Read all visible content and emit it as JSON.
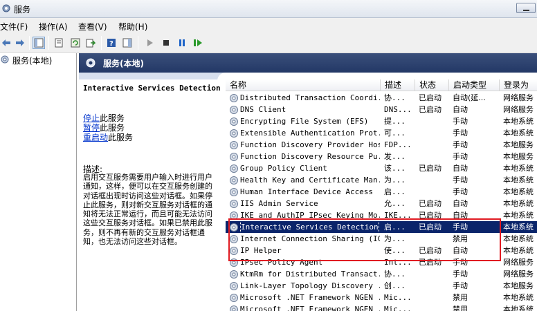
{
  "window": {
    "title": "服务"
  },
  "menu": {
    "file": "文件(F)",
    "action": "操作(A)",
    "view": "查看(V)",
    "help": "帮助(H)"
  },
  "toolbar": {
    "icons": [
      "back-arrow-icon",
      "forward-arrow-icon",
      "console-tree-icon",
      "properties-icon",
      "refresh-icon",
      "export-icon",
      "help-icon",
      "show-hide-icon",
      "start-icon",
      "stop-icon",
      "pause-icon",
      "restart-icon"
    ]
  },
  "tree": {
    "root_label": "服务(本地)"
  },
  "pane_header": {
    "title": "服务(本地)"
  },
  "details": {
    "service_name": "Interactive Services Detection",
    "actions": [
      {
        "link": "停止",
        "suffix": "此服务"
      },
      {
        "link": "暂停",
        "suffix": "此服务"
      },
      {
        "link": "重启动",
        "suffix": "此服务"
      }
    ],
    "description_label": "描述:",
    "description_text": "启用交互服务需要用户输入时进行用户通知，这样，便可以在交互服务创建的对话框出现时访问这些对话框。如果停止此服务，则对新交互服务对话框的通知将无法正常运行，而且可能无法访问这些交互服务对话框。如果已禁用此服务，则不再有新的交互服务对话框通知，也无法访问这些对话框。"
  },
  "columns": {
    "name": "名称",
    "description": "描述",
    "status": "状态",
    "startup_type": "启动类型",
    "logon_as": "登录为"
  },
  "services": [
    {
      "name": "Distributed Transaction Coordi...",
      "description": "协...",
      "status": "已启动",
      "startup": "自动(延...",
      "logon": "网络服务"
    },
    {
      "name": "DNS Client",
      "description": "DNS...",
      "status": "已启动",
      "startup": "自动",
      "logon": "网络服务"
    },
    {
      "name": "Encrypting File System (EFS)",
      "description": "提...",
      "status": "",
      "startup": "手动",
      "logon": "本地系统"
    },
    {
      "name": "Extensible Authentication Prot...",
      "description": "可...",
      "status": "",
      "startup": "手动",
      "logon": "本地系统"
    },
    {
      "name": "Function Discovery Provider Host",
      "description": "FDP...",
      "status": "",
      "startup": "手动",
      "logon": "本地服务"
    },
    {
      "name": "Function Discovery Resource Pu...",
      "description": "发...",
      "status": "",
      "startup": "手动",
      "logon": "本地服务"
    },
    {
      "name": "Group Policy Client",
      "description": "该...",
      "status": "已启动",
      "startup": "自动",
      "logon": "本地系统"
    },
    {
      "name": "Health Key and Certificate Man...",
      "description": "为...",
      "status": "",
      "startup": "手动",
      "logon": "本地系统"
    },
    {
      "name": "Human Interface Device Access",
      "description": "启...",
      "status": "",
      "startup": "手动",
      "logon": "本地系统"
    },
    {
      "name": "IIS Admin Service",
      "description": "允...",
      "status": "已启动",
      "startup": "自动",
      "logon": "本地系统"
    },
    {
      "name": "IKE and AuthIP IPsec Keying Mo...",
      "description": "IKE...",
      "status": "已启动",
      "startup": "自动",
      "logon": "本地系统"
    },
    {
      "name": "Interactive Services Detection",
      "description": "启...",
      "status": "已启动",
      "startup": "手动",
      "logon": "本地系统"
    },
    {
      "name": "Internet Connection Sharing (ICS)",
      "description": "为...",
      "status": "",
      "startup": "禁用",
      "logon": "本地系统"
    },
    {
      "name": "IP Helper",
      "description": "使...",
      "status": "已启动",
      "startup": "自动",
      "logon": "本地系统"
    },
    {
      "name": "IPsec Policy Agent",
      "description": "Int...",
      "status": "已启动",
      "startup": "手动",
      "logon": "网络服务"
    },
    {
      "name": "KtmRm for Distributed Transact...",
      "description": "协...",
      "status": "",
      "startup": "手动",
      "logon": "网络服务"
    },
    {
      "name": "Link-Layer Topology Discovery ...",
      "description": "创...",
      "status": "",
      "startup": "手动",
      "logon": "本地服务"
    },
    {
      "name": "Microsoft .NET Framework NGEN ...",
      "description": "Mic...",
      "status": "",
      "startup": "禁用",
      "logon": "本地系统"
    },
    {
      "name": "Microsoft .NET Framework NGEN ...",
      "description": "Mic...",
      "status": "",
      "startup": "禁用",
      "logon": "本地系统"
    }
  ],
  "selected_index": 11,
  "colors": {
    "header_bg": "#233866",
    "selection": "#0a246a",
    "highlight_box": "#e11b22",
    "link": "#0033cc"
  }
}
